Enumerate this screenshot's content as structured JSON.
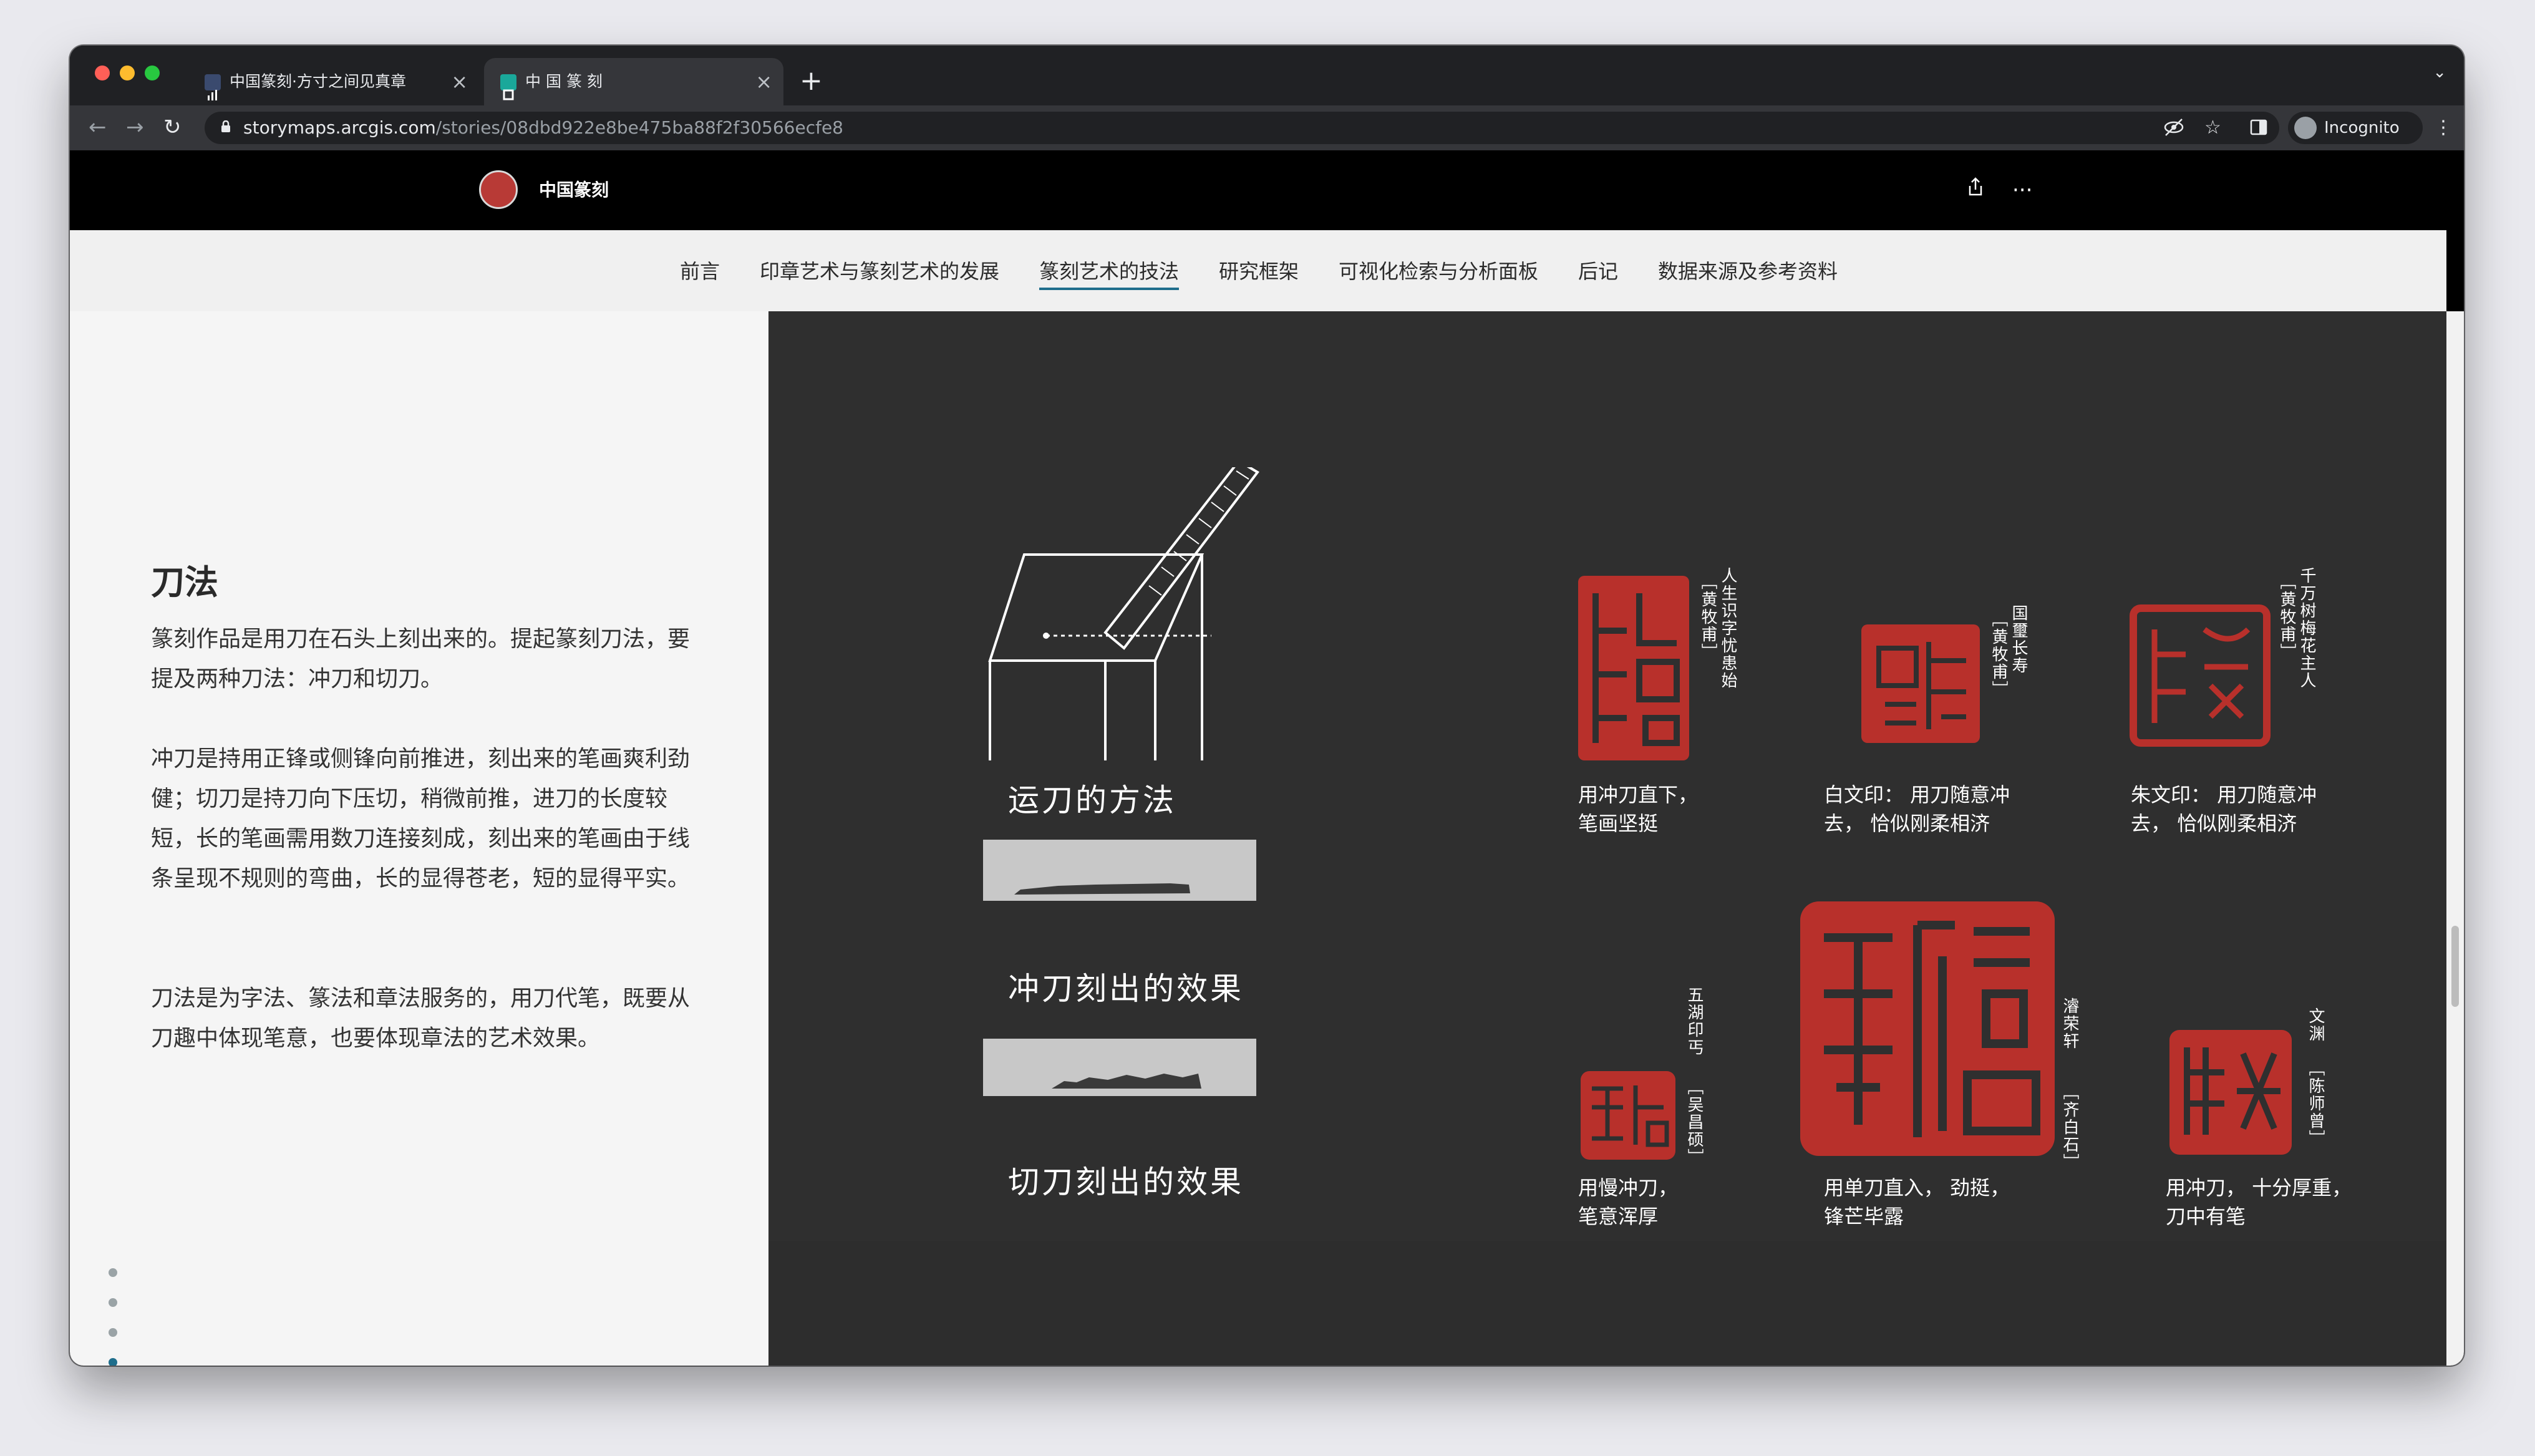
{
  "browser": {
    "tabs": [
      {
        "label": "中国篆刻·方寸之间见真章"
      },
      {
        "label": "中 国 篆 刻"
      }
    ],
    "url_host": "storymaps.arcgis.com",
    "url_path": "/stories/08dbd922e8be475ba88f2f30566ecfe8",
    "incognito_label": "Incognito"
  },
  "header": {
    "site_title": "中国篆刻"
  },
  "nav": {
    "items": [
      {
        "label": "前言"
      },
      {
        "label": "印章艺术与篆刻艺术的发展"
      },
      {
        "label": "篆刻艺术的技法"
      },
      {
        "label": "研究框架"
      },
      {
        "label": "可视化检索与分析面板"
      },
      {
        "label": "后记"
      },
      {
        "label": "数据来源及参考资料"
      }
    ],
    "active_index": 2
  },
  "narrative": {
    "heading": "刀法",
    "paragraphs": [
      "篆刻作品是用刀在石头上刻出来的。提起篆刻刀法，要提及两种刀法：冲刀和切刀。",
      "冲刀是持用正锋或侧锋向前推进，刻出来的笔画爽利劲健；切刀是持刀向下压切，稍微前推，进刀的长度较短，长的笔画需用数刀连接刻成，刻出来的笔画由于线条呈现不规则的弯曲，长的显得苍老，短的显得平实。",
      "刀法是为字法、篆法和章法服务的，用刀代笔，既要从刀趣中体现笔意，也要体现章法的艺术效果。"
    ],
    "progress_dots": 4,
    "active_dot": 3
  },
  "media": {
    "illustrations": [
      {
        "caption": "运刀的方法"
      },
      {
        "caption": "冲刀刻出的效果"
      },
      {
        "caption": "切刀刻出的效果"
      }
    ],
    "seals": [
      {
        "inscription": "人生识字忧患始",
        "author": "［黄牧甫］",
        "caption_lines": [
          "用冲刀直下，",
          "笔画坚挺"
        ]
      },
      {
        "inscription": "国璽长寿",
        "author": "［黄牧甫］",
        "caption_lines": [
          "白文印： 用刀随意冲",
          "去， 恰似刚柔相济"
        ]
      },
      {
        "inscription": "千万树梅花主人",
        "author": "［黄牧甫］",
        "caption_lines": [
          "朱文印： 用刀随意冲",
          "去， 恰似刚柔相济"
        ]
      },
      {
        "inscription": "五湖印丐",
        "author": "［吴昌硕］",
        "caption_lines": [
          "用慢冲刀，",
          "笔意浑厚"
        ]
      },
      {
        "inscription": "濬荣轩",
        "author": "［齐白石］",
        "caption_lines": [
          "用单刀直入， 劲挺，",
          "锋芒毕露"
        ]
      },
      {
        "inscription": "文渊",
        "author": "［陈师曾］",
        "caption_lines": [
          "用冲刀， 十分厚重，",
          "刀中有笔"
        ]
      }
    ],
    "seal_color": "#b8302b"
  },
  "colors": {
    "accent": "#1f6e8c",
    "media_bg": "#2f2f2f",
    "header_bg": "#000000"
  }
}
